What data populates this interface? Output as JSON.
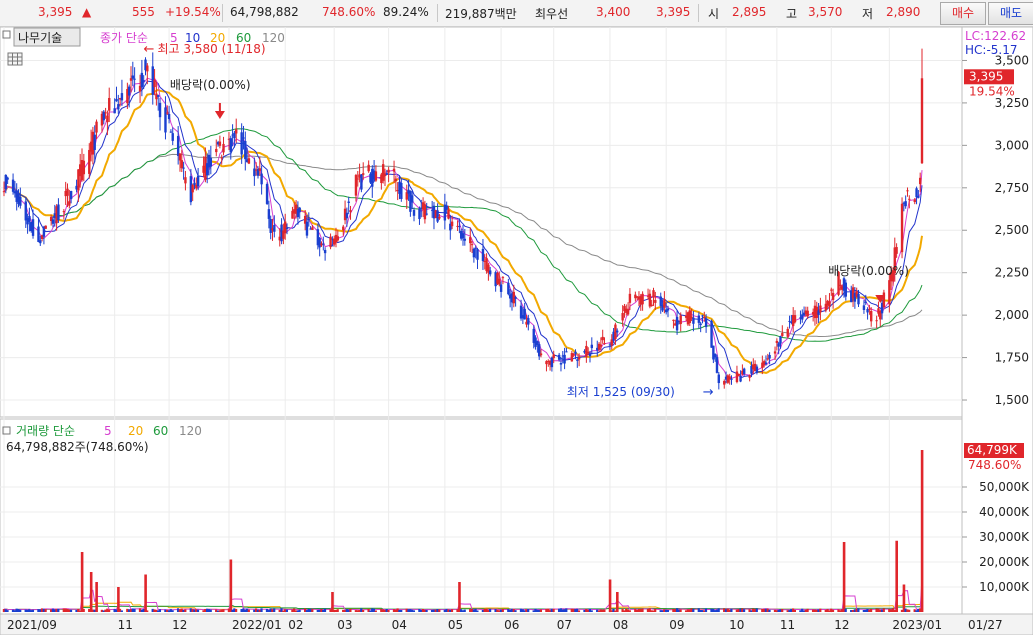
{
  "quote_bar": {
    "price": "3,395",
    "change": "555",
    "change_pct": "+19.54%",
    "volume": "64,798,882",
    "volume_ratio": "748.60%",
    "turnover_pct": "89.24%",
    "amount": "219,887백만",
    "best_ask_label": "최우선",
    "best_ask": "3,400",
    "best_bid": "3,395",
    "open_label": "시",
    "open": "2,895",
    "high_label": "고",
    "high": "3,570",
    "low_label": "저",
    "low": "2,890",
    "buy_label": "매수",
    "sell_label": "매도"
  },
  "toolbar": {
    "tree_label": "나무기술"
  },
  "colors": {
    "up": "#e0262b",
    "down": "#1a3fd0",
    "ma5": "#d63fd0",
    "ma10": "#2233cc",
    "ma20": "#f2a900",
    "ma60": "#1e9a3c",
    "ma120": "#8a8a8a"
  },
  "chart_data": [
    {
      "type": "candlestick",
      "legend": {
        "title": "종가 단순",
        "periods": [
          "5",
          "10",
          "20",
          "60",
          "120"
        ]
      },
      "ylim": [
        1400,
        3650
      ],
      "yticks": [
        "1,500",
        "1,750",
        "2,000",
        "2,250",
        "2,500",
        "2,750",
        "3,000",
        "3,250",
        "3,500"
      ],
      "xticks": [
        "2021/09",
        "11",
        "12",
        "2022/01",
        "02",
        "03",
        "04",
        "05",
        "06",
        "07",
        "08",
        "09",
        "10",
        "11",
        "12",
        "2023/01",
        "01/27"
      ],
      "right_labels": {
        "lc": "LC:122.62",
        "hc": "HC:-5.17",
        "last": "3,395",
        "last_pct": "19.54%"
      },
      "annotations": {
        "high": "최고 3,580 (11/18)",
        "low": "최저 1,525 (09/30)",
        "dividend1": "배당락(0.00%)",
        "dividend2": "배당락(0.00%)"
      },
      "anchors": [
        [
          "2021-09-01",
          2800
        ],
        [
          "2021-09-20",
          2450
        ],
        [
          "2021-10-10",
          2750
        ],
        [
          "2021-10-25",
          3150
        ],
        [
          "2021-11-18",
          3450
        ],
        [
          "2021-12-01",
          3100
        ],
        [
          "2021-12-12",
          2700
        ],
        [
          "2021-12-25",
          2950
        ],
        [
          "2022-01-07",
          3050
        ],
        [
          "2022-01-20",
          2800
        ],
        [
          "2022-01-28",
          2450
        ],
        [
          "2022-02-10",
          2600
        ],
        [
          "2022-02-24",
          2400
        ],
        [
          "2022-03-05",
          2500
        ],
        [
          "2022-03-15",
          2800
        ],
        [
          "2022-04-01",
          2850
        ],
        [
          "2022-04-10",
          2700
        ],
        [
          "2022-04-20",
          2600
        ],
        [
          "2022-05-01",
          2620
        ],
        [
          "2022-05-20",
          2350
        ],
        [
          "2022-06-01",
          2200
        ],
        [
          "2022-06-12",
          2050
        ],
        [
          "2022-06-25",
          1720
        ],
        [
          "2022-07-05",
          1750
        ],
        [
          "2022-07-20",
          1790
        ],
        [
          "2022-08-01",
          1850
        ],
        [
          "2022-08-12",
          2080
        ],
        [
          "2022-08-28",
          2100
        ],
        [
          "2022-09-05",
          1950
        ],
        [
          "2022-09-18",
          2000
        ],
        [
          "2022-09-25",
          1900
        ],
        [
          "2022-09-30",
          1600
        ],
        [
          "2022-10-12",
          1650
        ],
        [
          "2022-10-25",
          1700
        ],
        [
          "2022-11-08",
          1960
        ],
        [
          "2022-11-25",
          2020
        ],
        [
          "2022-12-05",
          2200
        ],
        [
          "2022-12-15",
          2100
        ],
        [
          "2022-12-25",
          1950
        ],
        [
          "2023-01-03",
          2200
        ],
        [
          "2023-01-10",
          2700
        ],
        [
          "2023-01-19",
          2750
        ],
        [
          "2023-01-20",
          3395
        ]
      ]
    },
    {
      "type": "bar",
      "legend": {
        "title": "거래량 단순",
        "periods": [
          "5",
          "20",
          "60",
          "120"
        ]
      },
      "subtitle": "64,798,882주(748.60%)",
      "ylim": [
        0,
        68000
      ],
      "yticks": [
        "10,000K",
        "20,000K",
        "30,000K",
        "40,000K",
        "50,000K"
      ],
      "right_labels": {
        "last": "64,799K",
        "last_pct": "748.60%"
      },
      "spikes": [
        [
          "2021-10-14",
          24000
        ],
        [
          "2021-10-19",
          16000
        ],
        [
          "2021-10-22",
          12000
        ],
        [
          "2021-11-03",
          10000
        ],
        [
          "2021-11-18",
          15000
        ],
        [
          "2022-01-04",
          21000
        ],
        [
          "2022-03-01",
          8000
        ],
        [
          "2022-05-10",
          12000
        ],
        [
          "2022-08-01",
          13000
        ],
        [
          "2022-08-05",
          8000
        ],
        [
          "2022-11-05",
          16000
        ],
        [
          "2022-11-26",
          10000
        ],
        [
          "2022-12-08",
          28000
        ],
        [
          "2022-12-25",
          9000
        ],
        [
          "2023-01-06",
          28500
        ],
        [
          "2023-01-10",
          11000
        ],
        [
          "2023-01-20",
          64799
        ]
      ]
    }
  ]
}
